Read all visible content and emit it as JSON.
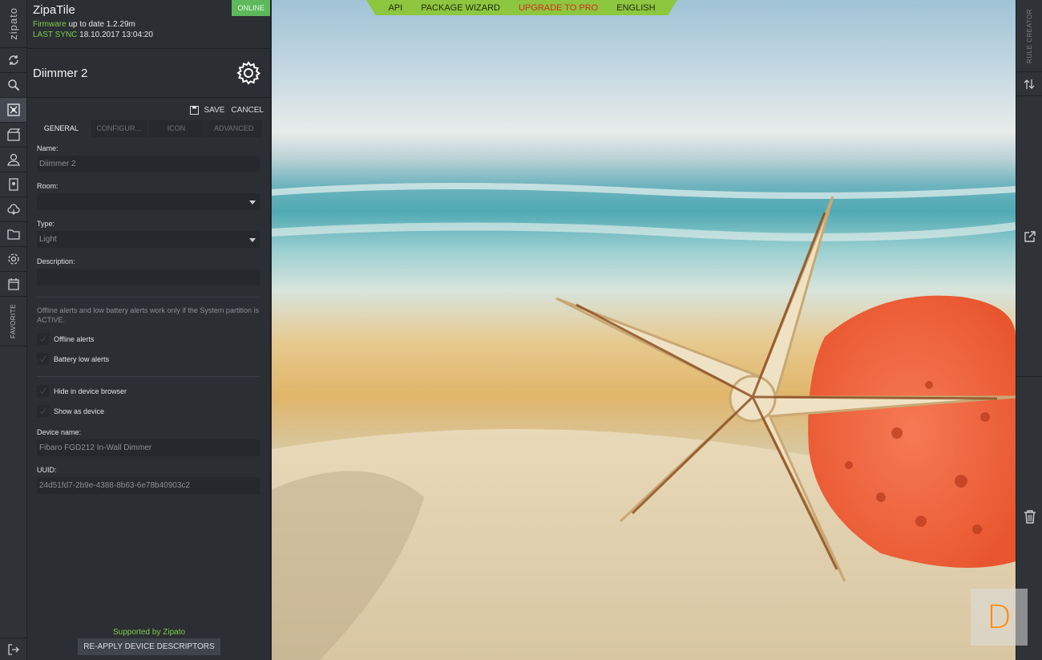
{
  "header": {
    "app_name": "ZipaTile",
    "status": "ONLINE",
    "firmware_label": "Firmware",
    "firmware_value": "up to date 1.2.29m",
    "last_sync_label": "LAST SYNC",
    "last_sync_value": "18.10.2017 13:04:20"
  },
  "rail": {
    "brand": "zipato",
    "favorite": "FAVORITE",
    "icons": [
      "sync-icon",
      "search-icon",
      "devices-icon",
      "scenes-icon",
      "users-icon",
      "contacts-icon",
      "cloud-icon",
      "folder-icon",
      "settings-icon",
      "calendar-icon"
    ]
  },
  "device": {
    "title": "Diimmer 2",
    "save": "SAVE",
    "cancel": "CANCEL",
    "tabs": [
      "GENERAL",
      "CONFIGUR...",
      "ICON",
      "ADVANCED"
    ],
    "name_label": "Name:",
    "name_value": "Diimmer 2",
    "room_label": "Room:",
    "room_value": "",
    "type_label": "Type:",
    "type_value": "Light",
    "description_label": "Description:",
    "description_value": "",
    "alerts_note": "Offline alerts and low battery alerts work only if the System partition is ACTIVE.",
    "offline_alerts": "Offline alerts",
    "battery_alerts": "Battery low alerts",
    "hide_browser": "Hide in device browser",
    "show_device": "Show as device",
    "device_name_label": "Device name:",
    "device_name_value": "Fibaro FGD212 In-Wall Dimmer",
    "uuid_label": "UUID:",
    "uuid_value": "24d51fd7-2b9e-4388-8b63-6e78b40903c2",
    "supported": "Supported by Zipato",
    "reapply": "RE-APPLY DEVICE DESCRIPTORS"
  },
  "topnav": {
    "api": "API",
    "wizard": "PACKAGE WIZARD",
    "upgrade": "UPGRADE TO PRO",
    "language": "ENGLISH"
  },
  "right_rail": {
    "rule_creator": "RULE CREATOR"
  },
  "corner_tile": "D",
  "colors": {
    "accent_green": "#8dc63f",
    "online_green": "#5cb85c",
    "upgrade_red": "#d32f1a",
    "panel_bg": "#2b2e33",
    "tile_orange": "#ff8a00"
  }
}
